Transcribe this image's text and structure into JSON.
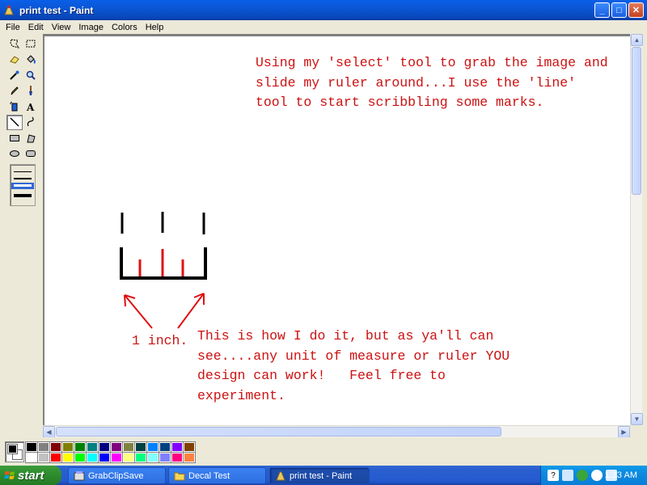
{
  "window": {
    "title": "print test - Paint",
    "buttons": {
      "minimize": "_",
      "maximize": "□",
      "close": "✕"
    }
  },
  "menu": [
    "File",
    "Edit",
    "View",
    "Image",
    "Colors",
    "Help"
  ],
  "tools": [
    {
      "name": "free-form-select-icon"
    },
    {
      "name": "select-icon"
    },
    {
      "name": "eraser-icon"
    },
    {
      "name": "fill-icon"
    },
    {
      "name": "pick-color-icon"
    },
    {
      "name": "magnifier-icon"
    },
    {
      "name": "pencil-icon"
    },
    {
      "name": "brush-icon"
    },
    {
      "name": "airbrush-icon"
    },
    {
      "name": "text-icon",
      "glyph": "A"
    },
    {
      "name": "line-icon",
      "selected": true
    },
    {
      "name": "curve-icon"
    },
    {
      "name": "rectangle-icon"
    },
    {
      "name": "polygon-icon"
    },
    {
      "name": "ellipse-icon"
    },
    {
      "name": "rounded-rectangle-icon"
    }
  ],
  "canvas": {
    "note_top": "Using my 'select' tool to grab the image and\nslide my ruler around...I use the 'line'\ntool to start scribbling some marks.",
    "label_inch": "1 inch.",
    "note_bottom": "This is how I do it, but as ya'll can\nsee....any unit of measure or ruler YOU\ndesign can work!   Feel free to\nexperiment.",
    "ink_color": "#cc1111"
  },
  "palette": {
    "foreground": "#000000",
    "background": "#ffffff",
    "colors": [
      "#000000",
      "#808080",
      "#800000",
      "#808000",
      "#008000",
      "#008080",
      "#000080",
      "#800080",
      "#808040",
      "#004040",
      "#0080ff",
      "#004080",
      "#8000ff",
      "#804000",
      "#ffffff",
      "#c0c0c0",
      "#ff0000",
      "#ffff00",
      "#00ff00",
      "#00ffff",
      "#0000ff",
      "#ff00ff",
      "#ffff80",
      "#00ff80",
      "#80ffff",
      "#8080ff",
      "#ff0080",
      "#ff8040"
    ]
  },
  "taskbar": {
    "start_label": "start",
    "tasks": [
      {
        "label": "GrabClipSave",
        "active": false
      },
      {
        "label": "Decal Test",
        "active": false
      },
      {
        "label": "print test - Paint",
        "active": true
      }
    ],
    "clock": "1:33 AM",
    "tray_icons": [
      "help-icon",
      "network-icon",
      "security-icon",
      "volume-icon",
      "update-icon"
    ]
  }
}
